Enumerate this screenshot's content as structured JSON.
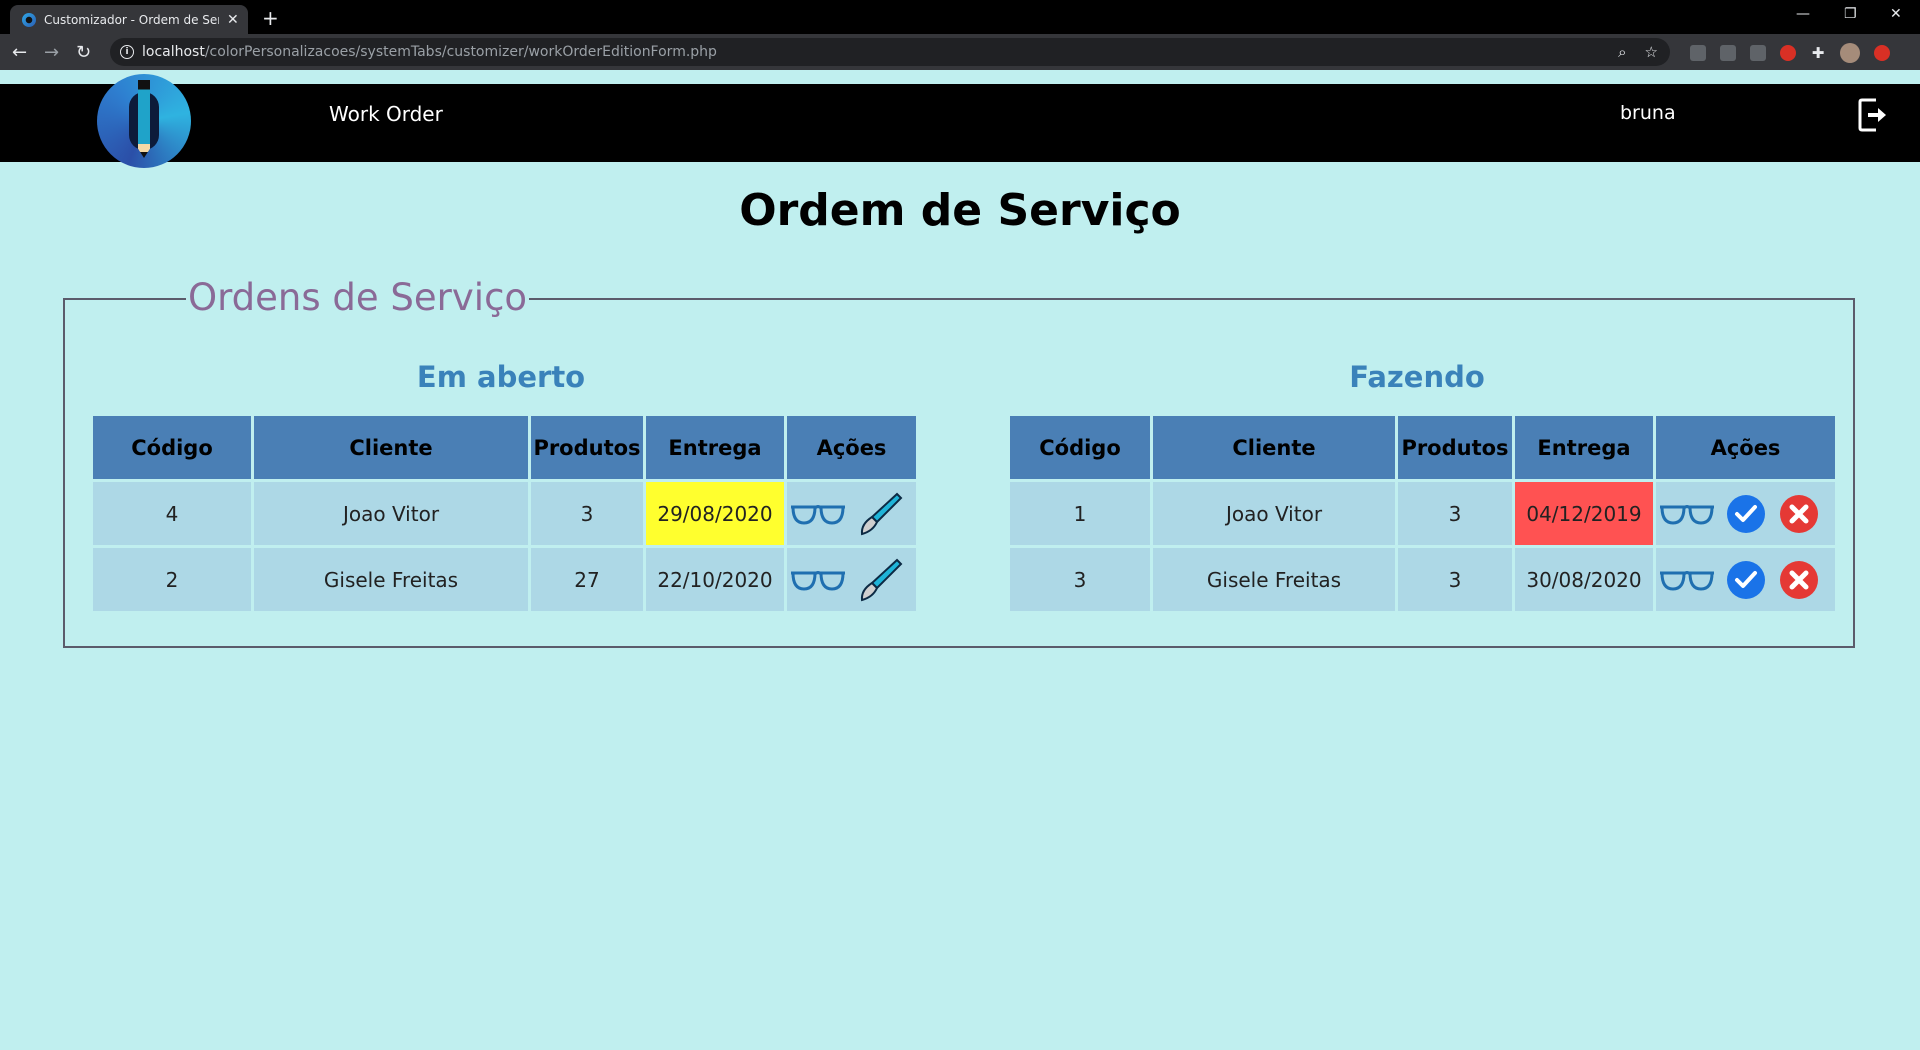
{
  "browser": {
    "tab_title": "Customizador - Ordem de Serviço",
    "url_host": "localhost",
    "url_path": "/colorPersonalizacoes/systemTabs/customizer/workOrderEditionForm.php"
  },
  "header": {
    "app_title": "Work Order",
    "user": "bruna"
  },
  "page": {
    "title": "Ordem de Serviço",
    "fieldset_legend": "Ordens de Serviço"
  },
  "colors": {
    "background": "#c0efef",
    "table_header": "#4a7fb5",
    "table_cell": "#add8e6",
    "warning_yellow": "#ffff2e",
    "overdue_red": "#ff5252",
    "section_title": "#3a82ba"
  },
  "open_orders": {
    "title": "Em aberto",
    "columns": [
      "Código",
      "Cliente",
      "Produtos",
      "Entrega",
      "Ações"
    ],
    "rows": [
      {
        "code": "4",
        "client": "Joao Vitor",
        "products": "3",
        "delivery": "29/08/2020",
        "status": "warning",
        "actions": [
          "view-icon",
          "edit-brush-icon"
        ]
      },
      {
        "code": "2",
        "client": "Gisele Freitas",
        "products": "27",
        "delivery": "22/10/2020",
        "status": "normal",
        "actions": [
          "view-icon",
          "edit-brush-icon"
        ]
      }
    ]
  },
  "doing_orders": {
    "title": "Fazendo",
    "columns": [
      "Código",
      "Cliente",
      "Produtos",
      "Entrega",
      "Ações"
    ],
    "rows": [
      {
        "code": "1",
        "client": "Joao Vitor",
        "products": "3",
        "delivery": "04/12/2019",
        "status": "overdue",
        "actions": [
          "view-icon",
          "complete-check-icon",
          "cancel-x-icon"
        ]
      },
      {
        "code": "3",
        "client": "Gisele Freitas",
        "products": "3",
        "delivery": "30/08/2020",
        "status": "normal",
        "actions": [
          "view-icon",
          "complete-check-icon",
          "cancel-x-icon"
        ]
      }
    ]
  }
}
